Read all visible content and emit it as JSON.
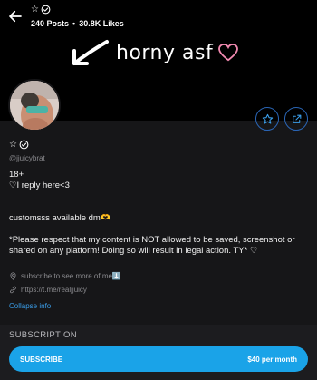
{
  "header": {
    "title": "☆",
    "posts": "240 Posts",
    "separator": "•",
    "likes": "30.8K Likes"
  },
  "banner": {
    "text": "horny asf"
  },
  "profile": {
    "name": "☆",
    "handle": "@jjuicybrat",
    "bio_lines": [
      "18+",
      "♡I reply here<3",
      "",
      "",
      "customsss available dm🫶",
      "",
      "*Please respect that my content is NOT allowed to be saved, screenshot or shared on any platform! Doing so will result in legal action. TY* ♡"
    ],
    "location": "subscribe to see more of me⬇️",
    "link": "https://t.me/realjjuicy",
    "collapse_label": "Collapse info"
  },
  "subscription": {
    "section_title": "SUBSCRIPTION",
    "button_label": "SUBSCRIBE",
    "price": "$40 per month"
  },
  "colors": {
    "accent": "#1aa3e8",
    "link": "#3a9de8",
    "panel": "#161618",
    "verified_outline": "#ffffff"
  },
  "icons": [
    "back-arrow-icon",
    "verified-icon",
    "star-icon",
    "share-icon",
    "location-pin-icon",
    "link-icon",
    "heart-icon",
    "banner-arrow-icon"
  ]
}
